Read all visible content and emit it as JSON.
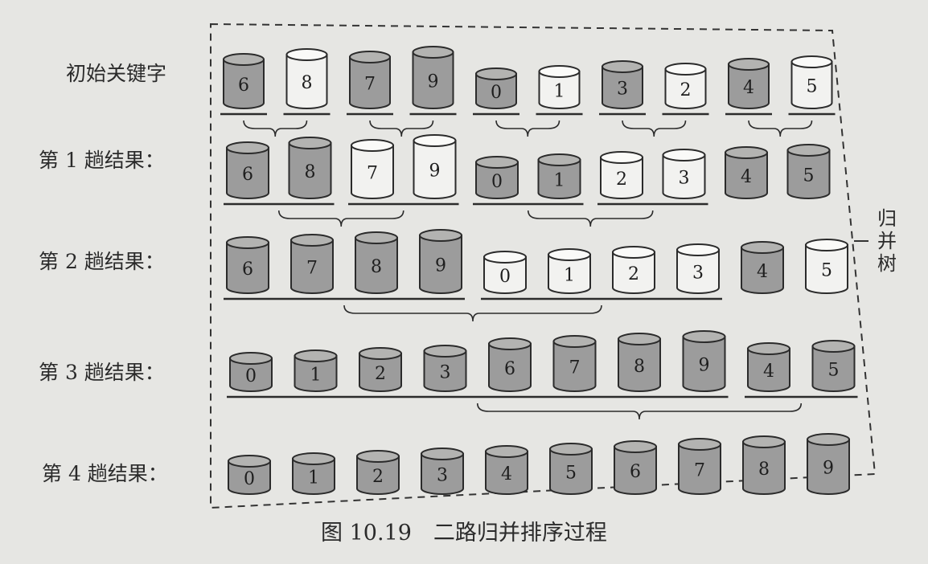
{
  "row_labels": [
    "初始关键字",
    "第 1 趟结果：",
    "第 2 趟结果：",
    "第 3 趟结果：",
    "第 4 趟结果："
  ],
  "rows": [
    {
      "items": [
        {
          "v": "6",
          "shade": true
        },
        {
          "v": "8",
          "shade": false
        },
        {
          "v": "7",
          "shade": true
        },
        {
          "v": "9",
          "shade": true
        },
        {
          "v": "0",
          "shade": true
        },
        {
          "v": "1",
          "shade": false
        },
        {
          "v": "3",
          "shade": true
        },
        {
          "v": "2",
          "shade": false
        },
        {
          "v": "4",
          "shade": true
        },
        {
          "v": "5",
          "shade": false
        }
      ],
      "groups": [
        [
          0,
          0
        ],
        [
          1,
          1
        ],
        [
          2,
          2
        ],
        [
          3,
          3
        ],
        [
          4,
          4
        ],
        [
          5,
          5
        ],
        [
          6,
          6
        ],
        [
          7,
          7
        ],
        [
          8,
          8
        ],
        [
          9,
          9
        ]
      ]
    },
    {
      "items": [
        {
          "v": "6",
          "shade": true
        },
        {
          "v": "8",
          "shade": true
        },
        {
          "v": "7",
          "shade": false
        },
        {
          "v": "9",
          "shade": false
        },
        {
          "v": "0",
          "shade": true
        },
        {
          "v": "1",
          "shade": true
        },
        {
          "v": "2",
          "shade": false
        },
        {
          "v": "3",
          "shade": false
        },
        {
          "v": "4",
          "shade": true
        },
        {
          "v": "5",
          "shade": true
        }
      ],
      "groups": [
        [
          0,
          1
        ],
        [
          2,
          3
        ],
        [
          4,
          5
        ],
        [
          6,
          7
        ]
      ]
    },
    {
      "items": [
        {
          "v": "6",
          "shade": true
        },
        {
          "v": "7",
          "shade": true
        },
        {
          "v": "8",
          "shade": true
        },
        {
          "v": "9",
          "shade": true
        },
        {
          "v": "0",
          "shade": false
        },
        {
          "v": "1",
          "shade": false
        },
        {
          "v": "2",
          "shade": false
        },
        {
          "v": "3",
          "shade": false
        },
        {
          "v": "4",
          "shade": true
        },
        {
          "v": "5",
          "shade": false
        }
      ],
      "groups": [
        [
          0,
          3
        ],
        [
          4,
          7
        ]
      ]
    },
    {
      "items": [
        {
          "v": "0",
          "shade": true
        },
        {
          "v": "1",
          "shade": true
        },
        {
          "v": "2",
          "shade": true
        },
        {
          "v": "3",
          "shade": true
        },
        {
          "v": "6",
          "shade": true
        },
        {
          "v": "7",
          "shade": true
        },
        {
          "v": "8",
          "shade": true
        },
        {
          "v": "9",
          "shade": true
        },
        {
          "v": "4",
          "shade": true
        },
        {
          "v": "5",
          "shade": true
        }
      ],
      "groups": [
        [
          0,
          7
        ],
        [
          8,
          9
        ]
      ]
    },
    {
      "items": [
        {
          "v": "0",
          "shade": true
        },
        {
          "v": "1",
          "shade": true
        },
        {
          "v": "2",
          "shade": true
        },
        {
          "v": "3",
          "shade": true
        },
        {
          "v": "4",
          "shade": true
        },
        {
          "v": "5",
          "shade": true
        },
        {
          "v": "6",
          "shade": true
        },
        {
          "v": "7",
          "shade": true
        },
        {
          "v": "8",
          "shade": true
        },
        {
          "v": "9",
          "shade": true
        }
      ],
      "groups": []
    }
  ],
  "side_label": [
    "归",
    "并",
    "树"
  ],
  "caption": "图 10.19　二路归并排序过程",
  "colors": {
    "paper": "#e6e6e3",
    "ink": "#2b2b2b",
    "shade": "#9c9c9c",
    "shade_top": "#b3b3b1",
    "light": "#f2f2f0"
  }
}
